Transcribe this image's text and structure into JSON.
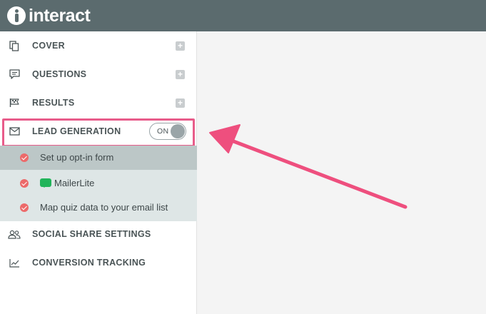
{
  "app": {
    "logo_text": "interact"
  },
  "sidebar": {
    "items": [
      {
        "id": "cover",
        "label": "COVER",
        "icon": "copy-pages-icon",
        "has_add": true
      },
      {
        "id": "questions",
        "label": "QUESTIONS",
        "icon": "chat-bubble-icon",
        "has_add": true
      },
      {
        "id": "results",
        "label": "RESULTS",
        "icon": "flag-icon",
        "has_add": true
      },
      {
        "id": "lead-generation",
        "label": "LEAD GENERATION",
        "icon": "envelope-icon",
        "toggle_label": "ON",
        "toggle_on": true
      },
      {
        "id": "social-share",
        "label": "SOCIAL SHARE SETTINGS",
        "icon": "users-icon"
      },
      {
        "id": "conversion-tracking",
        "label": "CONVERSION TRACKING",
        "icon": "line-chart-icon"
      }
    ],
    "add_symbol": "+"
  },
  "lead_generation": {
    "sub_items": [
      {
        "label": "Set up opt-in form",
        "status": "complete",
        "active": true
      },
      {
        "label": "MailerLite",
        "status": "complete",
        "icon": "mailerlite-logo-icon"
      },
      {
        "label": "Map quiz data to your email list",
        "status": "complete"
      }
    ]
  },
  "colors": {
    "topbar": "#5b6b6e",
    "highlight_border": "#e85c8a",
    "arrow": "#ee4f7e",
    "check": "#ec6a6a",
    "mailerlite": "#21b45a"
  }
}
